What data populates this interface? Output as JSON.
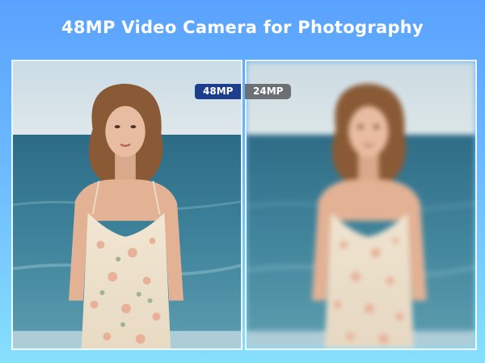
{
  "headline": "48MP Video Camera for Photography",
  "comparison": {
    "left_label": "48MP",
    "right_label": "24MP"
  },
  "colors": {
    "background_top": "#5aa2ff",
    "background_bottom": "#86e0fb",
    "badge_high": "#1d3e8c",
    "badge_low": "#6c6f73"
  }
}
